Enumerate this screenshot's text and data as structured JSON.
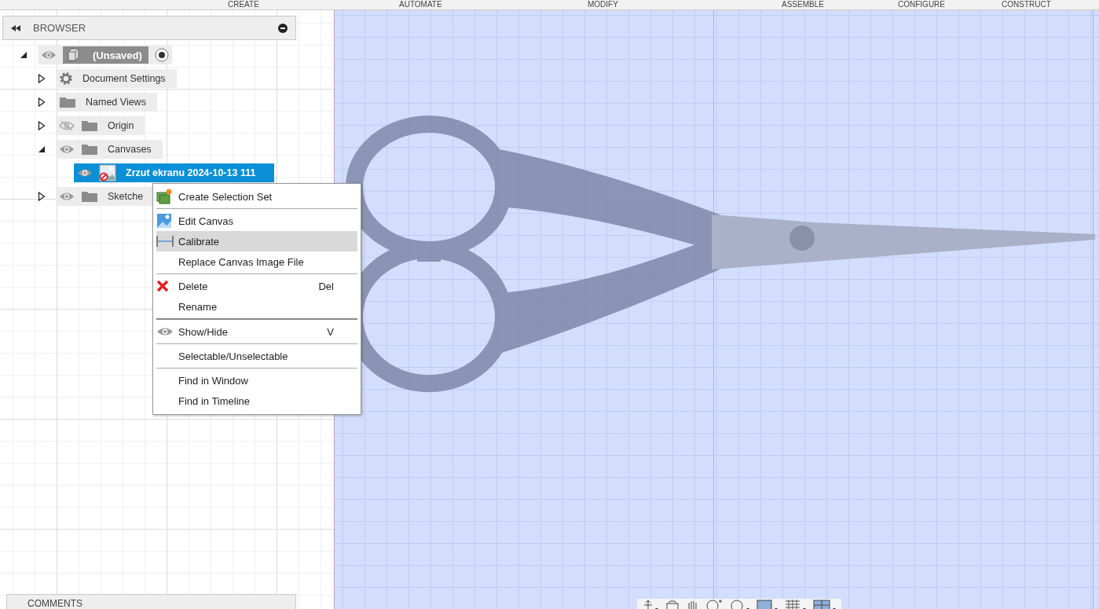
{
  "toolbar": {
    "tabs": [
      {
        "label": "CREATE"
      },
      {
        "label": "AUTOMATE"
      },
      {
        "label": "MODIFY"
      },
      {
        "label": "ASSEMBLE"
      },
      {
        "label": "CONFIGURE"
      },
      {
        "label": "CONSTRUCT"
      }
    ]
  },
  "browser": {
    "title": "BROWSER",
    "tree": [
      {
        "label": "(Unsaved)",
        "kind": "component",
        "visible": true,
        "expanded": true,
        "selected": false,
        "children": [
          {
            "label": "Document Settings",
            "kind": "settings",
            "expanded": false,
            "selected": false
          },
          {
            "label": "Named Views",
            "kind": "folder",
            "expanded": false,
            "selected": false
          },
          {
            "label": "Origin",
            "kind": "folder",
            "visible": false,
            "expanded": false,
            "selected": false
          },
          {
            "label": "Canvases",
            "kind": "folder",
            "visible": true,
            "expanded": true,
            "selected": false,
            "children": [
              {
                "label": "Zrzut ekranu 2024-10-13 111",
                "kind": "canvas",
                "visible": true,
                "selected": true
              }
            ]
          },
          {
            "label": "Sketche",
            "kind": "folder",
            "visible": true,
            "expanded": false,
            "selected": false
          }
        ]
      }
    ]
  },
  "context_menu": {
    "groups": [
      [
        {
          "label": "Create Selection Set",
          "kind": "selection-set",
          "selected": false
        }
      ],
      [
        {
          "label": "Edit Canvas",
          "kind": "image",
          "selected": false
        },
        {
          "label": "Calibrate",
          "kind": "calibrate",
          "selected": true
        },
        {
          "label": "Replace Canvas Image File",
          "selected": false
        }
      ],
      [
        {
          "label": "Delete",
          "kind": "delete",
          "shortcut": "Del",
          "selected": false
        },
        {
          "label": "Rename",
          "selected": false
        }
      ],
      [
        {
          "label": "Show/Hide",
          "kind": "eye",
          "shortcut": "V",
          "selected": false
        }
      ],
      [
        {
          "label": "Selectable/Unselectable",
          "selected": false
        }
      ],
      [
        {
          "label": "Find in Window",
          "selected": false
        },
        {
          "label": "Find in Timeline",
          "selected": false
        }
      ]
    ]
  },
  "comments": {
    "title": "COMMENTS"
  }
}
